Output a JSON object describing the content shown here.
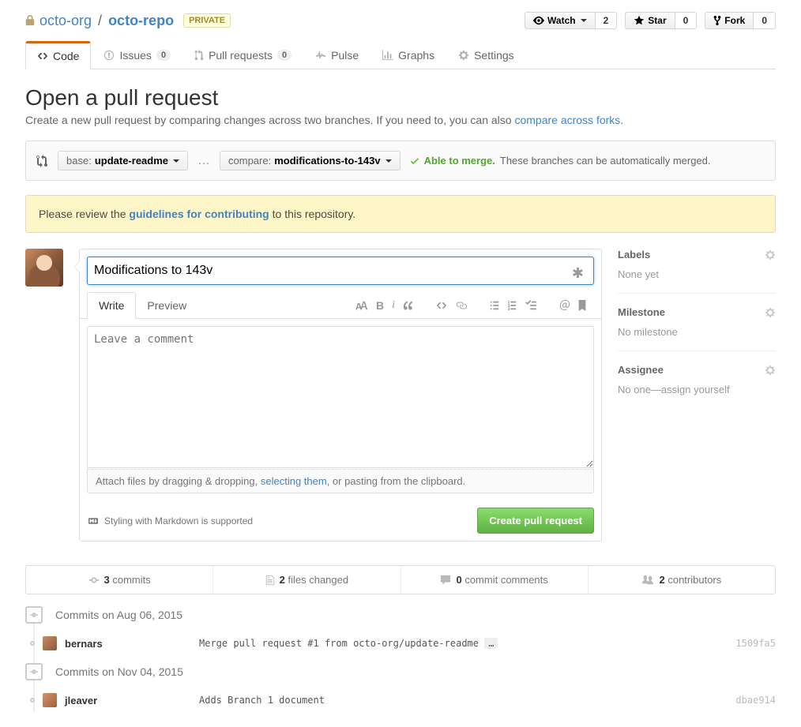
{
  "repo": {
    "org": "octo-org",
    "name": "octo-repo",
    "privacy": "Private"
  },
  "social": {
    "watch": {
      "label": "Watch",
      "count": "2"
    },
    "star": {
      "label": "Star",
      "count": "0"
    },
    "fork": {
      "label": "Fork",
      "count": "0"
    }
  },
  "tabs": {
    "code": "Code",
    "issues": {
      "label": "Issues",
      "count": "0"
    },
    "pulls": {
      "label": "Pull requests",
      "count": "0"
    },
    "pulse": "Pulse",
    "graphs": "Graphs",
    "settings": "Settings"
  },
  "page": {
    "title": "Open a pull request",
    "subtitle_pre": "Create a new pull request by comparing changes across two branches. If you need to, you can also ",
    "subtitle_link": "compare across forks",
    "subtitle_post": "."
  },
  "compare": {
    "base_label": "base:",
    "base_branch": "update-readme",
    "compare_label": "compare:",
    "compare_branch": "modifications-to-143v",
    "able": "Able to merge.",
    "msg": "These branches can be automatically merged."
  },
  "flash": {
    "pre": "Please review the ",
    "link": "guidelines for contributing",
    "post": " to this repository."
  },
  "form": {
    "title_value": "Modifications to 143v",
    "write_tab": "Write",
    "preview_tab": "Preview",
    "comment_placeholder": "Leave a comment",
    "attach_pre": "Attach files by dragging & dropping, ",
    "attach_link": "selecting them",
    "attach_post": ", or pasting from the clipboard.",
    "md_note": "Styling with Markdown is supported",
    "submit": "Create pull request"
  },
  "sidebar": {
    "labels": {
      "title": "Labels",
      "content": "None yet"
    },
    "milestone": {
      "title": "Milestone",
      "content": "No milestone"
    },
    "assignee": {
      "title": "Assignee",
      "content": "No one—assign yourself"
    }
  },
  "stats": {
    "commits": {
      "count": "3",
      "label": "commits"
    },
    "files": {
      "count": "2",
      "label": "files changed"
    },
    "comments": {
      "count": "0",
      "label": "commit comments"
    },
    "contributors": {
      "count": "2",
      "label": "contributors"
    }
  },
  "commits": {
    "group1": {
      "title": "Commits on Aug 06, 2015",
      "items": [
        {
          "author": "bernars",
          "message": "Merge pull request #1 from octo-org/update-readme",
          "sha": "1509fa5"
        }
      ]
    },
    "group2": {
      "title": "Commits on Nov 04, 2015",
      "items": [
        {
          "author": "jleaver",
          "message": "Adds Branch 1 document",
          "sha": "dbae914"
        }
      ]
    }
  }
}
